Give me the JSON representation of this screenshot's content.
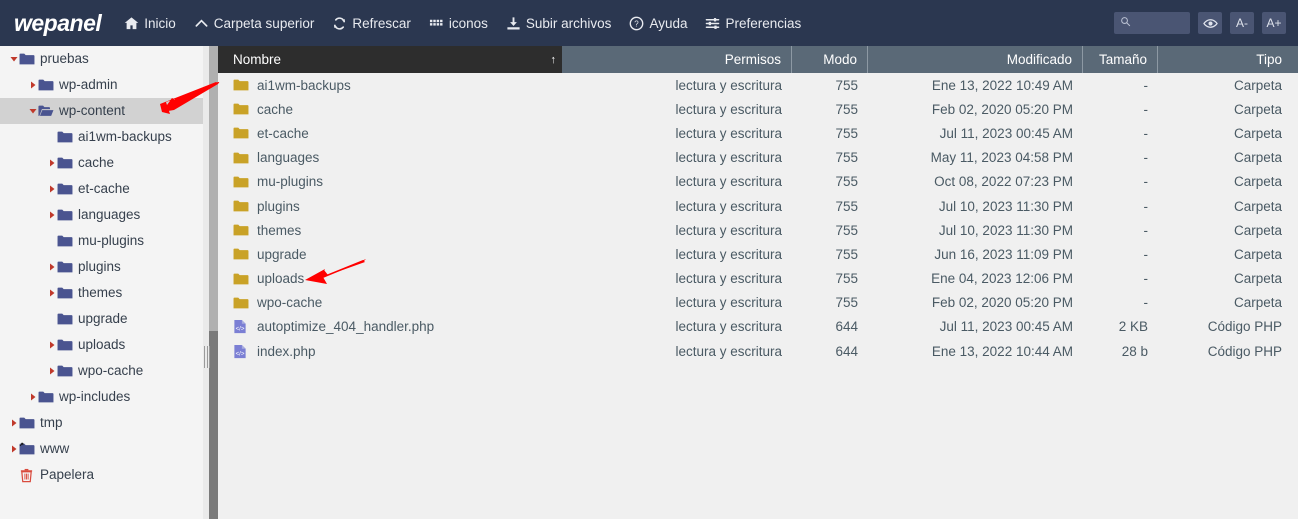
{
  "header": {
    "brand": "wepanel",
    "nav": [
      {
        "label": "Inicio",
        "icon": "home-icon"
      },
      {
        "label": "Carpeta superior",
        "icon": "chevron-up-icon"
      },
      {
        "label": "Refrescar",
        "icon": "refresh-icon"
      },
      {
        "label": "iconos",
        "icon": "grid-icon"
      },
      {
        "label": "Subir archivos",
        "icon": "upload-icon"
      },
      {
        "label": "Ayuda",
        "icon": "question-circle-icon"
      },
      {
        "label": "Preferencias",
        "icon": "sliders-icon"
      }
    ],
    "search": {
      "value": "",
      "placeholder": "",
      "icon": "search-icon"
    },
    "buttons": [
      {
        "label": "",
        "name": "eye-icon",
        "icon": "eye-icon"
      },
      {
        "label": "A-",
        "name": "font-decrease-button",
        "icon": "text-smaller-icon"
      },
      {
        "label": "A+",
        "name": "font-increase-button",
        "icon": "text-larger-icon"
      }
    ],
    "bg_color": "#2b3750"
  },
  "sidebar": {
    "items": [
      {
        "label": "pruebas",
        "depth": 0,
        "caret": "down",
        "icon": "folder-icon",
        "selected": false
      },
      {
        "label": "wp-admin",
        "depth": 1,
        "caret": "right",
        "icon": "folder-icon",
        "selected": false
      },
      {
        "label": "wp-content",
        "depth": 1,
        "caret": "down",
        "icon": "folder-open-icon",
        "selected": true
      },
      {
        "label": "ai1wm-backups",
        "depth": 2,
        "caret": "none",
        "icon": "folder-icon",
        "selected": false
      },
      {
        "label": "cache",
        "depth": 2,
        "caret": "right",
        "icon": "folder-icon",
        "selected": false
      },
      {
        "label": "et-cache",
        "depth": 2,
        "caret": "right",
        "icon": "folder-icon",
        "selected": false
      },
      {
        "label": "languages",
        "depth": 2,
        "caret": "right",
        "icon": "folder-icon",
        "selected": false
      },
      {
        "label": "mu-plugins",
        "depth": 2,
        "caret": "none",
        "icon": "folder-icon",
        "selected": false
      },
      {
        "label": "plugins",
        "depth": 2,
        "caret": "right",
        "icon": "folder-icon",
        "selected": false
      },
      {
        "label": "themes",
        "depth": 2,
        "caret": "right",
        "icon": "folder-icon",
        "selected": false
      },
      {
        "label": "upgrade",
        "depth": 2,
        "caret": "none",
        "icon": "folder-icon",
        "selected": false
      },
      {
        "label": "uploads",
        "depth": 2,
        "caret": "right",
        "icon": "folder-icon",
        "selected": false
      },
      {
        "label": "wpo-cache",
        "depth": 2,
        "caret": "right",
        "icon": "folder-icon",
        "selected": false
      },
      {
        "label": "wp-includes",
        "depth": 1,
        "caret": "right",
        "icon": "folder-icon",
        "selected": false
      },
      {
        "label": "tmp",
        "depth": 0,
        "caret": "right",
        "icon": "folder-icon",
        "selected": false
      },
      {
        "label": "www",
        "depth": 0,
        "caret": "right",
        "icon": "folder-link-icon",
        "selected": false
      },
      {
        "label": "Papelera",
        "depth": 0,
        "caret": "none",
        "icon": "trash-icon",
        "selected": false
      }
    ],
    "selected_color": "#d2d2d2"
  },
  "table": {
    "columns": [
      {
        "key": "name",
        "label": "Nombre",
        "sorted": true,
        "sort_dir": "asc",
        "sort_icon": "sort-asc-arrow"
      },
      {
        "key": "perm",
        "label": "Permisos",
        "sorted": false
      },
      {
        "key": "mode",
        "label": "Modo",
        "sorted": false
      },
      {
        "key": "mod",
        "label": "Modificado",
        "sorted": false
      },
      {
        "key": "size",
        "label": "Tamaño",
        "sorted": false
      },
      {
        "key": "type",
        "label": "Tipo",
        "sorted": false
      }
    ],
    "rows": [
      {
        "name": "ai1wm-backups",
        "icon": "folder-icon",
        "perm": "lectura y escritura",
        "mode": "755",
        "mod": "Ene 13, 2022 10:49 AM",
        "size": "-",
        "type": "Carpeta"
      },
      {
        "name": "cache",
        "icon": "folder-icon",
        "perm": "lectura y escritura",
        "mode": "755",
        "mod": "Feb 02, 2020 05:20 PM",
        "size": "-",
        "type": "Carpeta"
      },
      {
        "name": "et-cache",
        "icon": "folder-icon",
        "perm": "lectura y escritura",
        "mode": "755",
        "mod": "Jul 11, 2023 00:45 AM",
        "size": "-",
        "type": "Carpeta"
      },
      {
        "name": "languages",
        "icon": "folder-icon",
        "perm": "lectura y escritura",
        "mode": "755",
        "mod": "May 11, 2023 04:58 PM",
        "size": "-",
        "type": "Carpeta"
      },
      {
        "name": "mu-plugins",
        "icon": "folder-icon",
        "perm": "lectura y escritura",
        "mode": "755",
        "mod": "Oct 08, 2022 07:23 PM",
        "size": "-",
        "type": "Carpeta"
      },
      {
        "name": "plugins",
        "icon": "folder-icon",
        "perm": "lectura y escritura",
        "mode": "755",
        "mod": "Jul 10, 2023 11:30 PM",
        "size": "-",
        "type": "Carpeta"
      },
      {
        "name": "themes",
        "icon": "folder-icon",
        "perm": "lectura y escritura",
        "mode": "755",
        "mod": "Jul 10, 2023 11:30 PM",
        "size": "-",
        "type": "Carpeta"
      },
      {
        "name": "upgrade",
        "icon": "folder-icon",
        "perm": "lectura y escritura",
        "mode": "755",
        "mod": "Jun 16, 2023 11:09 PM",
        "size": "-",
        "type": "Carpeta"
      },
      {
        "name": "uploads",
        "icon": "folder-icon",
        "perm": "lectura y escritura",
        "mode": "755",
        "mod": "Ene 04, 2023 12:06 PM",
        "size": "-",
        "type": "Carpeta"
      },
      {
        "name": "wpo-cache",
        "icon": "folder-icon",
        "perm": "lectura y escritura",
        "mode": "755",
        "mod": "Feb 02, 2020 05:20 PM",
        "size": "-",
        "type": "Carpeta"
      },
      {
        "name": "autoptimize_404_handler.php",
        "icon": "php-file-icon",
        "perm": "lectura y escritura",
        "mode": "644",
        "mod": "Jul 11, 2023 00:45 AM",
        "size": "2 KB",
        "type": "Código PHP"
      },
      {
        "name": "index.php",
        "icon": "php-file-icon",
        "perm": "lectura y escritura",
        "mode": "644",
        "mod": "Ene 13, 2022 10:44 AM",
        "size": "28 b",
        "type": "Código PHP"
      }
    ],
    "header_bg": "#5a6977",
    "sorted_col_bg": "#2d2d2d",
    "folder_icon_color": "#c9a227",
    "php_icon_color": "#7b7fd4"
  },
  "annotations": [
    {
      "name": "arrow-pointing-to-wp-content",
      "color": "#ff0000"
    },
    {
      "name": "arrow-pointing-to-uploads",
      "color": "#ff0000"
    }
  ]
}
